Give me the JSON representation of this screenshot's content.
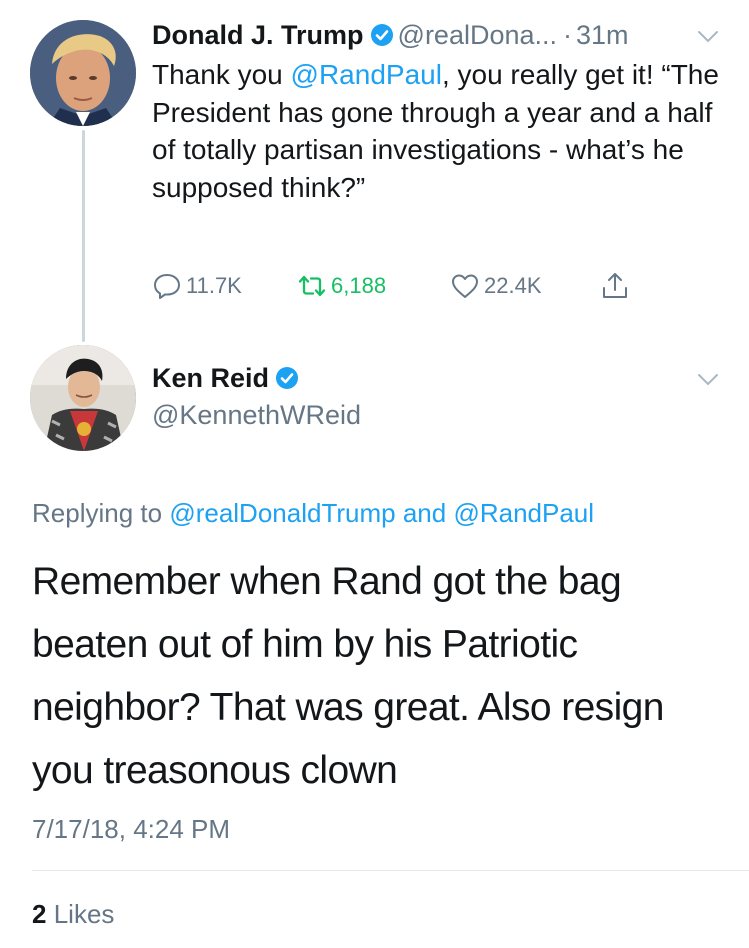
{
  "original_tweet": {
    "author_name": "Donald J. Trump",
    "handle": "@realDona...",
    "separator": "·",
    "time_ago": "31m",
    "text_prefix": "Thank you ",
    "mention": "@RandPaul",
    "text_suffix": ", you really get it! “The President has gone through a year and a half of totally partisan investigations - what’s he supposed think?”",
    "replies": "11.7K",
    "retweets": "6,188",
    "likes": "22.4K",
    "icons": [
      "reply-icon",
      "retweet-icon",
      "like-icon",
      "share-icon",
      "verified-icon",
      "chevron-down-icon"
    ]
  },
  "reply_tweet": {
    "author_name": "Ken Reid",
    "handle": "@KennethWReid",
    "replying_prefix": "Replying to ",
    "replying_to_1": "@realDonaldTrump",
    "replying_and": " and ",
    "replying_to_2": "@RandPaul",
    "text": "Remember when Rand got the bag beaten out of him by his Patriotic neighbor? That was great. Also resign you treasonous clown",
    "timestamp": "7/17/18, 4:24 PM",
    "like_count": "2",
    "like_label": "Likes"
  },
  "colors": {
    "link_blue": "#1da1f2",
    "secondary_gray": "#657786",
    "retweet_green": "#17bf63",
    "verified_blue": "#1da1f2"
  }
}
